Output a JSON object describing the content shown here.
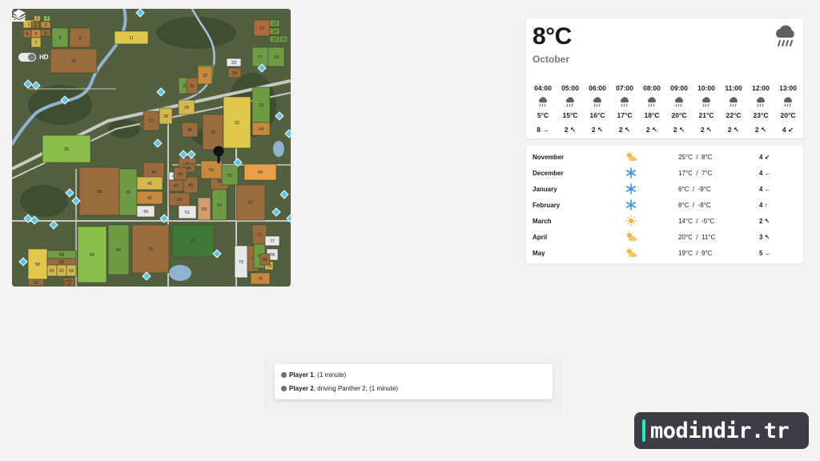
{
  "map": {
    "hd_label": "HD",
    "layer_badges": [
      "2",
      "3"
    ],
    "field_numbers": [
      {
        "n": "1"
      },
      {
        "n": "2"
      },
      {
        "n": "3"
      },
      {
        "n": "4"
      },
      {
        "n": "5"
      },
      {
        "n": "6"
      },
      {
        "n": "7"
      },
      {
        "n": "8"
      },
      {
        "n": "9"
      },
      {
        "n": "10"
      },
      {
        "n": "11"
      },
      {
        "n": "12"
      },
      {
        "n": "13"
      },
      {
        "n": "14"
      },
      {
        "n": "15"
      },
      {
        "n": "16"
      },
      {
        "n": "17"
      },
      {
        "n": "18"
      },
      {
        "n": "19"
      },
      {
        "n": "20"
      },
      {
        "n": "21"
      },
      {
        "n": "22"
      },
      {
        "n": "23"
      },
      {
        "n": "24"
      },
      {
        "n": "25"
      },
      {
        "n": "26"
      },
      {
        "n": "27"
      },
      {
        "n": "28"
      },
      {
        "n": "29"
      },
      {
        "n": "30"
      },
      {
        "n": "31"
      },
      {
        "n": "32"
      },
      {
        "n": "33"
      },
      {
        "n": "34"
      },
      {
        "n": "35"
      },
      {
        "n": "36"
      },
      {
        "n": "37"
      },
      {
        "n": "38"
      },
      {
        "n": "39"
      },
      {
        "n": "40"
      },
      {
        "n": "41"
      },
      {
        "n": "42"
      },
      {
        "n": "43"
      },
      {
        "n": "44"
      },
      {
        "n": "45"
      },
      {
        "n": "46"
      },
      {
        "n": "47"
      },
      {
        "n": "48"
      },
      {
        "n": "49"
      },
      {
        "n": "50"
      },
      {
        "n": "51"
      },
      {
        "n": "52"
      },
      {
        "n": "53"
      },
      {
        "n": "54"
      },
      {
        "n": "55"
      },
      {
        "n": "56"
      },
      {
        "n": "57"
      },
      {
        "n": "58"
      },
      {
        "n": "59"
      },
      {
        "n": "60"
      },
      {
        "n": "61"
      },
      {
        "n": "62"
      },
      {
        "n": "63"
      },
      {
        "n": "64"
      },
      {
        "n": "65"
      },
      {
        "n": "66"
      },
      {
        "n": "67"
      },
      {
        "n": "68"
      },
      {
        "n": "69"
      },
      {
        "n": "70"
      },
      {
        "n": "71"
      },
      {
        "n": "72"
      },
      {
        "n": "73"
      },
      {
        "n": "74"
      },
      {
        "n": "75"
      },
      {
        "n": "76"
      },
      {
        "n": "77"
      },
      {
        "n": "78"
      },
      {
        "n": "79"
      },
      {
        "n": "80"
      }
    ],
    "colors": {
      "base": "#4d5b3c",
      "road": "#c9c9c2",
      "river": "#8fb3d1",
      "water": "#8fb3d1",
      "marker": "#5bc5e8"
    }
  },
  "weather": {
    "current_temp": "8°C",
    "current_month": "October",
    "current_icon": "rain-cloud-icon",
    "hours": [
      {
        "time": "04:00",
        "temp": "5°C",
        "wind": "8",
        "dir": "→"
      },
      {
        "time": "05:00",
        "temp": "15°C",
        "wind": "2",
        "dir": "↖"
      },
      {
        "time": "06:00",
        "temp": "16°C",
        "wind": "2",
        "dir": "↖"
      },
      {
        "time": "07:00",
        "temp": "17°C",
        "wind": "2",
        "dir": "↖"
      },
      {
        "time": "08:00",
        "temp": "18°C",
        "wind": "2",
        "dir": "↖"
      },
      {
        "time": "09:00",
        "temp": "20°C",
        "wind": "2",
        "dir": "↖"
      },
      {
        "time": "10:00",
        "temp": "21°C",
        "wind": "2",
        "dir": "↖"
      },
      {
        "time": "11:00",
        "temp": "22°C",
        "wind": "2",
        "dir": "↖"
      },
      {
        "time": "12:00",
        "temp": "23°C",
        "wind": "2",
        "dir": "↖"
      },
      {
        "time": "13:00",
        "temp": "20°C",
        "wind": "4",
        "dir": "↙"
      }
    ]
  },
  "forecast": [
    {
      "month": "November",
      "icon": "sun-cloud-icon",
      "high": "25°C",
      "low": "8°C",
      "wind": "4",
      "dir": "↙"
    },
    {
      "month": "December",
      "icon": "snowflake-icon",
      "high": "17°C",
      "low": "7°C",
      "wind": "4",
      "dir": "←"
    },
    {
      "month": "January",
      "icon": "snowflake-icon",
      "high": "6°C",
      "low": "-9°C",
      "wind": "4",
      "dir": "←"
    },
    {
      "month": "February",
      "icon": "snowflake-icon",
      "high": "8°C",
      "low": "-8°C",
      "wind": "4",
      "dir": "↑"
    },
    {
      "month": "March",
      "icon": "sun-icon",
      "high": "14°C",
      "low": "-5°C",
      "wind": "2",
      "dir": "↖"
    },
    {
      "month": "April",
      "icon": "sun-cloud-icon",
      "high": "20°C",
      "low": "11°C",
      "wind": "3",
      "dir": "↖"
    },
    {
      "month": "May",
      "icon": "sun-cloud-icon",
      "high": "19°C",
      "low": "9°C",
      "wind": "5",
      "dir": "←"
    }
  ],
  "temp_separator": "/",
  "players": [
    {
      "name": "Player 1",
      "status": ", (1 minute)"
    },
    {
      "name": "Player 2",
      "status": ", driving Panther 2, (1 minute)"
    }
  ],
  "watermark": {
    "text": "modindir.tr",
    "accent": "#2ee6b8"
  }
}
